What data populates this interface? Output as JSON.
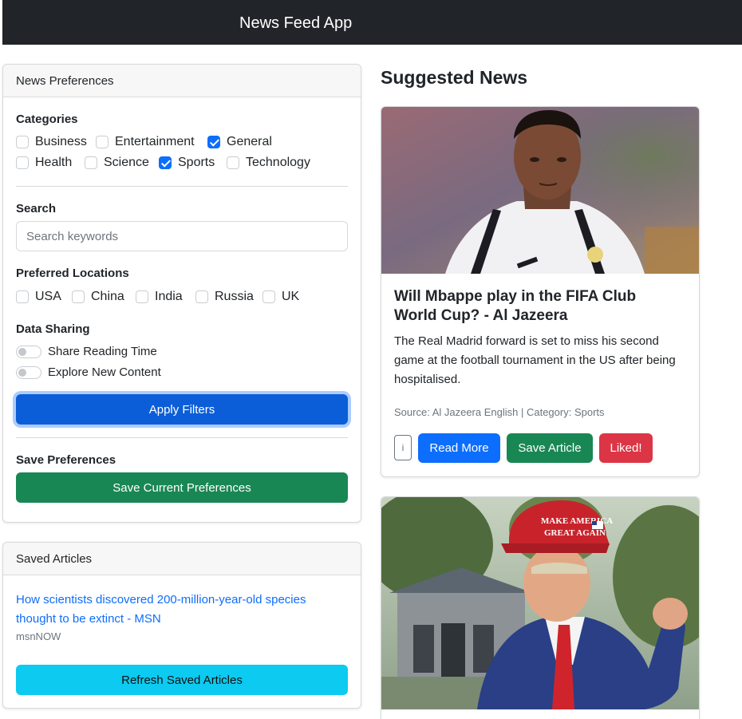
{
  "navbar": {
    "brand": "News Feed App"
  },
  "preferences": {
    "header": "News Preferences",
    "categories_label": "Categories",
    "categories": [
      {
        "label": "Business",
        "checked": false
      },
      {
        "label": "Entertainment",
        "checked": false
      },
      {
        "label": "General",
        "checked": true
      },
      {
        "label": "Health",
        "checked": false
      },
      {
        "label": "Science",
        "checked": false
      },
      {
        "label": "Sports",
        "checked": true
      },
      {
        "label": "Technology",
        "checked": false
      }
    ],
    "search_label": "Search",
    "search_placeholder": "Search keywords",
    "locations_label": "Preferred Locations",
    "locations": [
      {
        "label": "USA",
        "checked": false
      },
      {
        "label": "China",
        "checked": false
      },
      {
        "label": "India",
        "checked": false
      },
      {
        "label": "Russia",
        "checked": false
      },
      {
        "label": "UK",
        "checked": false
      }
    ],
    "data_sharing_label": "Data Sharing",
    "toggles": [
      {
        "label": "Share Reading Time",
        "on": false
      },
      {
        "label": "Explore New Content",
        "on": false
      }
    ],
    "apply_button": "Apply Filters",
    "save_prefs_label": "Save Preferences",
    "save_prefs_button": "Save Current Preferences"
  },
  "saved_articles": {
    "header": "Saved Articles",
    "items": [
      {
        "title": "How scientists discovered 200-million-year-old species thought to be extinct - MSN",
        "source": "msnNOW"
      }
    ],
    "refresh_button": "Refresh Saved Articles"
  },
  "suggested": {
    "heading": "Suggested News",
    "articles": [
      {
        "title": "Will Mbappe play in the FIFA Club World Cup? - Al Jazeera",
        "description": "The Real Madrid forward is set to miss his second game at the football tournament in the US after being hospitalised.",
        "meta": "Source: Al Jazeera English | Category: Sports",
        "info_button": "i",
        "read_more": "Read More",
        "save_article": "Save Article",
        "liked": "Liked!"
      },
      {
        "cap_text_1": "MAKE AMERICA",
        "cap_text_2": "GREAT AGAIN"
      }
    ]
  },
  "colors": {
    "navbar": "#212529",
    "primary": "#0d6efd",
    "success": "#198754",
    "danger": "#dc3545",
    "info": "#0dcaf0"
  }
}
